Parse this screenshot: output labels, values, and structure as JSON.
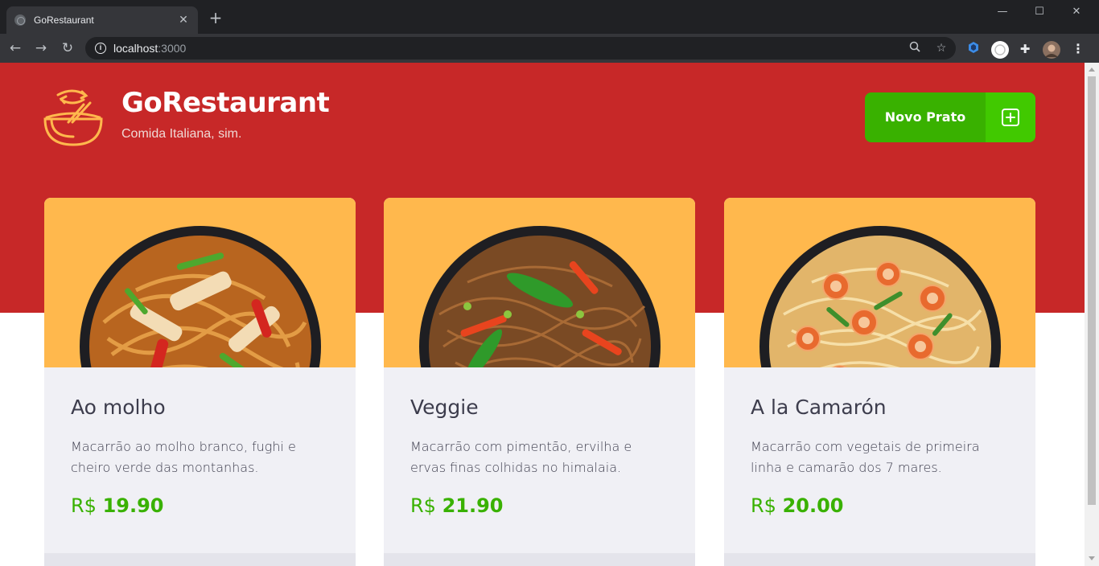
{
  "browser": {
    "tab_title": "GoRestaurant",
    "url_host": "localhost",
    "url_port": ":3000"
  },
  "header": {
    "title": "GoRestaurant",
    "subtitle": "Comida Italiana, sim.",
    "new_dish_label": "Novo Prato"
  },
  "foods": [
    {
      "name": "Ao molho",
      "description": "Macarrão ao molho branco, fughi e cheiro verde das montanhas.",
      "currency": "R$",
      "price": "19.90",
      "accent": "#d9892b"
    },
    {
      "name": "Veggie",
      "description": "Macarrão com pimentão, ervilha e ervas finas colhidas no himalaia.",
      "currency": "R$",
      "price": "21.90",
      "accent": "#8a5a2b"
    },
    {
      "name": "A la Camarón",
      "description": "Macarrão com vegetais de primeira linha e camarão dos 7 mares.",
      "currency": "R$",
      "price": "20.00",
      "accent": "#f0a050"
    }
  ],
  "colors": {
    "header_bg": "#c72828",
    "card_top": "#ffb84d",
    "card_body": "#f0f0f5",
    "price": "#39b100",
    "button": "#39b100",
    "button_icon_bg": "#41c900"
  },
  "icons": {
    "logo": "bowl-icon",
    "new_dish": "plus-square-icon"
  }
}
